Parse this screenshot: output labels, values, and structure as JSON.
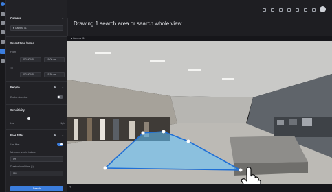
{
  "page": {
    "title": "Drawing 1 search area or search whole view"
  },
  "sidebar": {
    "camera": {
      "title": "Camera",
      "selected": "■ Camera 01"
    },
    "time": {
      "title": "Select time frame",
      "from_label": "From",
      "from_date": "2024/01/20",
      "from_time": "11:00 am",
      "to_label": "To",
      "to_date": "2024/01/20",
      "to_time": "11:30 am"
    },
    "people": {
      "title": "People",
      "enable_label": "Enable detection"
    },
    "sensitivity": {
      "title": "Sensitivity",
      "min_label": "Low",
      "max_label": "High",
      "level": 0.35
    },
    "free_filter": {
      "title": "Free filter",
      "use_filter_label": "Use filter",
      "min_area_label": "Minimum area to include",
      "min_area_value": "5%",
      "duration_label": "Duration/dwell time (s)",
      "duration_value": "100"
    },
    "search_button": "Search"
  },
  "viewer": {
    "camera_label": "■ Camera 01"
  },
  "colors": {
    "accent": "#3b7ddd",
    "zone_fill": "#63c5ff",
    "zone_stroke": "#1f6fd6"
  }
}
